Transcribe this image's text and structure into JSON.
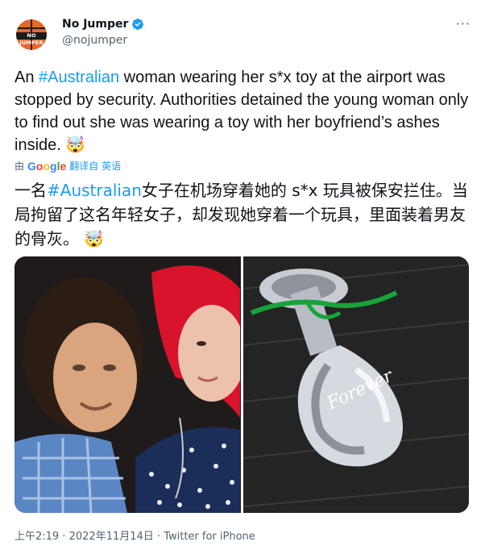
{
  "author": {
    "display_name": "No Jumper",
    "handle": "@nojumper",
    "avatar_text": "NO JUMPER",
    "verified": true
  },
  "tweet": {
    "prefix": "An ",
    "hashtag": "#Australian",
    "body": " woman wearing her s*x toy at the airport was stopped by security. Authorities detained the young woman only to find out she was wearing a toy with her boyfriend’s ashes inside.",
    "emoji": "🤯"
  },
  "translation": {
    "by_label": "由",
    "provider": "Google",
    "link_text": "翻译自 英语",
    "prefix": "一名",
    "hashtag": "#Australian",
    "body": "女子在机场穿着她的 s*x 玩具被保安拦住。当局拘留了这名年轻女子，却发现她穿着一个玩具，里面装着男友的骨灰。",
    "emoji": "🤯"
  },
  "media": {
    "left_photo": "couple-photo",
    "right_photo": "plug-photo",
    "engraving": "Forever"
  },
  "footer": {
    "time": "上午2:19",
    "date": "2022年11月14日",
    "source": "Twitter for iPhone",
    "separator": " · "
  },
  "more_icon": "more-icon",
  "colors": {
    "accent": "#1d9bf0",
    "secondary": "#536471"
  }
}
